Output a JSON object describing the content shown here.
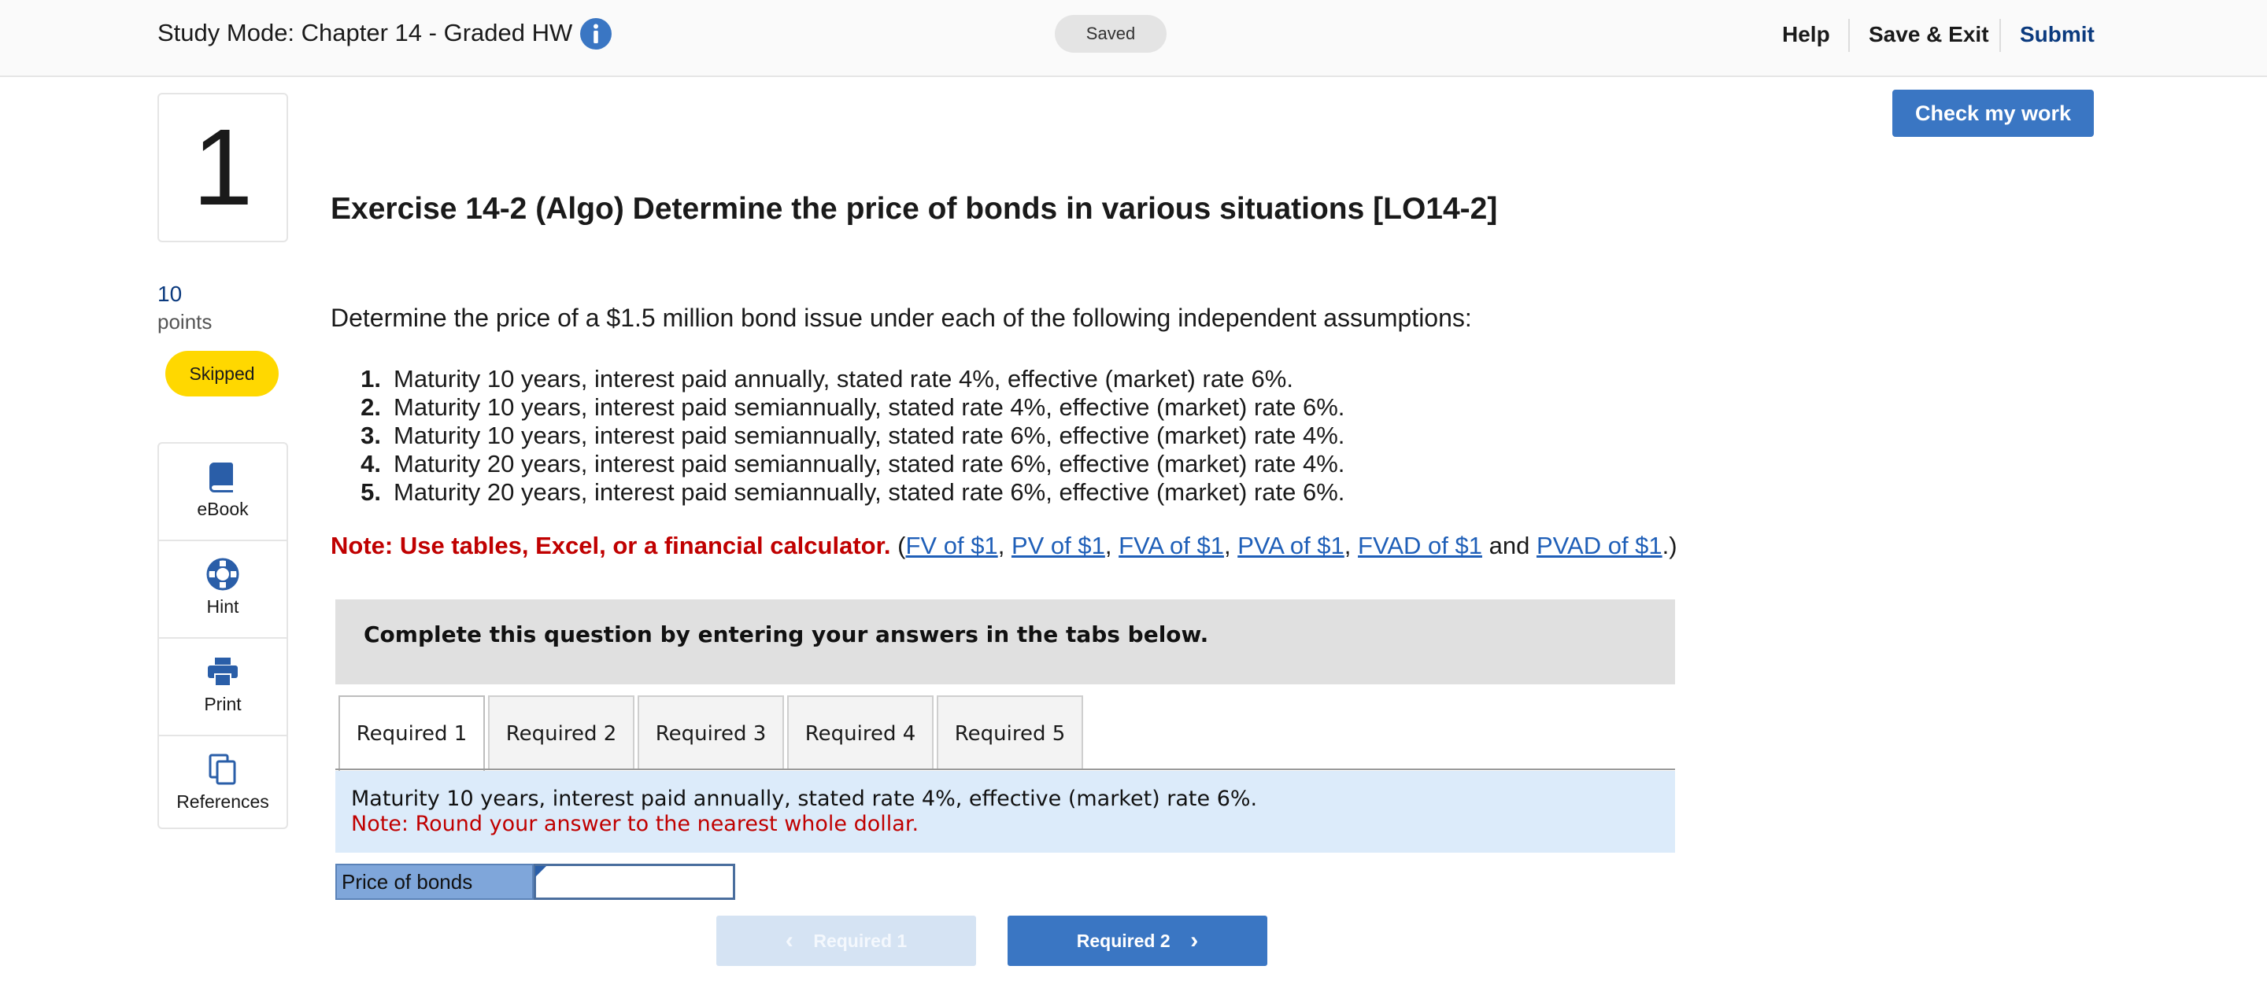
{
  "header": {
    "title": "Study Mode: Chapter 14 - Graded HW",
    "info_icon": "info-circle-icon",
    "saved_status": "Saved",
    "help": "Help",
    "save_exit": "Save & Exit",
    "submit": "Submit"
  },
  "question": {
    "number": "1",
    "points_value": "10",
    "points_label": "points",
    "status": "Skipped"
  },
  "tools": [
    {
      "label": "eBook",
      "icon": "book-icon"
    },
    {
      "label": "Hint",
      "icon": "lifebuoy-icon"
    },
    {
      "label": "Print",
      "icon": "printer-icon"
    },
    {
      "label": "References",
      "icon": "copy-documents-icon"
    }
  ],
  "check_work_label": "Check my work",
  "exercise": {
    "title": "Exercise 14-2 (Algo) Determine the price of bonds in various situations [LO14-2]",
    "intro": "Determine the price of a $1.5 million bond issue under each of the following independent assumptions:",
    "assumptions": [
      {
        "num": "1.",
        "text": "Maturity 10 years, interest paid annually, stated rate 4%, effective (market) rate 6%."
      },
      {
        "num": "2.",
        "text": "Maturity 10 years, interest paid semiannually, stated rate 4%, effective (market) rate 6%."
      },
      {
        "num": "3.",
        "text": "Maturity 10 years, interest paid semiannually, stated rate 6%, effective (market) rate 4%."
      },
      {
        "num": "4.",
        "text": "Maturity 20 years, interest paid semiannually, stated rate 6%, effective (market) rate 4%."
      },
      {
        "num": "5.",
        "text": "Maturity 20 years, interest paid semiannually, stated rate 6%, effective (market) rate 6%."
      }
    ],
    "note_prefix": "Note: Use tables, Excel, or a financial calculator.",
    "paren_open": "(",
    "links": [
      "FV of $1",
      "PV of $1",
      "FVA of $1",
      "PVA of $1",
      "FVAD of $1",
      "PVAD of $1"
    ],
    "comma": ",",
    "and": "and",
    "paren_close": ".)"
  },
  "instructions": "Complete this question by entering your answers in the tabs below.",
  "tabs": [
    "Required 1",
    "Required 2",
    "Required 3",
    "Required 4",
    "Required 5"
  ],
  "active_tab": "Required 1",
  "panel": {
    "description": "Maturity 10 years, interest paid annually, stated rate 4%, effective (market) rate 6%.",
    "note": "Note: Round your answer to the nearest whole dollar."
  },
  "answer": {
    "label": "Price of bonds",
    "value": ""
  },
  "nav": {
    "prev_label": "Required 1",
    "next_label": "Required 2"
  }
}
